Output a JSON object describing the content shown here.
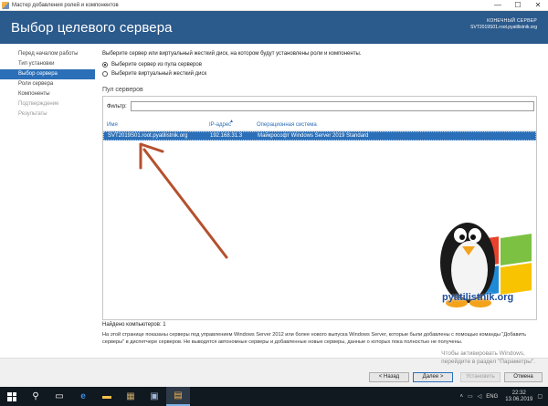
{
  "window": {
    "title": "Мастер добавления ролей и компонентов",
    "ctrl_minimize": "—",
    "ctrl_maximize": "☐",
    "ctrl_close": "✕"
  },
  "header": {
    "page_title": "Выбор целевого сервера",
    "dest_label": "КОНЕЧНЫЙ СЕРВЕР",
    "dest_value": "SVT2019S01.root.pyatilistnik.org"
  },
  "nav": {
    "items": [
      {
        "label": "Перед началом работы"
      },
      {
        "label": "Тип установки"
      },
      {
        "label": "Выбор сервера"
      },
      {
        "label": "Роли сервера"
      },
      {
        "label": "Компоненты"
      },
      {
        "label": "Подтверждение"
      },
      {
        "label": "Результаты"
      }
    ]
  },
  "content": {
    "instruction": "Выберите сервер или виртуальный жесткий диск, на котором будут установлены роли и компоненты.",
    "option_pool": "Выберите сервер из пула серверов",
    "option_vhd": "Выберите виртуальный жесткий диск",
    "pool_heading": "Пул серверов",
    "filter_label": "Фильтр:",
    "filter_value": "",
    "columns": {
      "name": "Имя",
      "ip": "IP-адрес",
      "os": "Операционная система"
    },
    "rows": [
      {
        "name": "SVT2019S01.root.pyatilistnik.org",
        "ip": "192.168.31.3",
        "os": "Майкрософт Windows Server 2019 Standard"
      }
    ],
    "found": "Найдено компьютеров: 1",
    "note": "На этой странице показаны серверы под управлением Windows Server 2012 или более нового выпуска Windows Server, которые были добавлены с помощью команды \"Добавить серверы\" в диспетчере серверов. Не выводятся автономные серверы и добавленные новые серверы, данные о которых пока полностью не получены."
  },
  "watermark": {
    "line1": "Чтобы активировать Windows,",
    "line2": "перейдите в раздел \"Параметры\"."
  },
  "logo": {
    "text": "pyatilistnik.org"
  },
  "buttons": {
    "back": "< Назад",
    "next": "Далее >",
    "install": "Установить",
    "cancel": "Отмена"
  },
  "taskbar": {
    "lang": "ENG",
    "time": "22:32",
    "date": "13.06.2019"
  }
}
